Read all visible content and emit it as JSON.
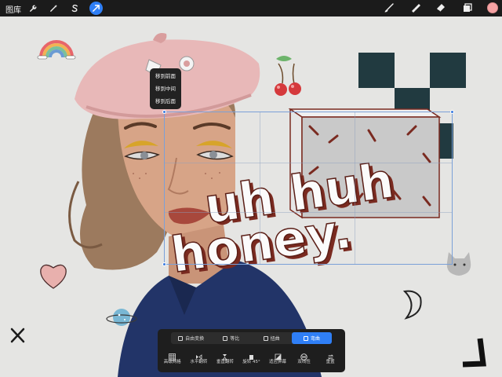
{
  "topbar": {
    "gallery_label": "图库",
    "left_tools": [
      {
        "icon": "wrench-icon",
        "active": false
      },
      {
        "icon": "magic-wand-icon",
        "active": false
      },
      {
        "icon": "selection-s-icon",
        "active": false
      },
      {
        "icon": "transform-arrow-icon",
        "active": true
      }
    ],
    "right_tools": [
      "brush-icon",
      "smudge-icon",
      "eraser-icon",
      "layers-icon"
    ],
    "current_color": "#f6a3a4"
  },
  "context_menu": {
    "items": [
      "移到前面",
      "移到中间",
      "移到后面"
    ]
  },
  "transform_panel": {
    "modes": [
      {
        "label": "自由变换",
        "active": false
      },
      {
        "label": "等比",
        "active": false
      },
      {
        "label": "扭曲",
        "active": false
      },
      {
        "label": "弯曲",
        "active": true
      }
    ],
    "tools": [
      {
        "label": "高级网格",
        "icon": "grid-icon"
      },
      {
        "label": "水平翻转",
        "icon": "flip-horizontal-icon"
      },
      {
        "label": "垂直翻转",
        "icon": "flip-vertical-icon"
      },
      {
        "label": "旋转 45°",
        "icon": "rotate-icon"
      },
      {
        "label": "适应屏幕",
        "icon": "fit-screen-icon"
      },
      {
        "label": "双线性",
        "icon": "bilinear-icon"
      },
      {
        "label": "重置",
        "icon": "reset-icon"
      }
    ]
  },
  "artwork": {
    "text_line_1": "uh huh",
    "text_line_2": "honey.",
    "accent_color": "#2f7ff6"
  }
}
